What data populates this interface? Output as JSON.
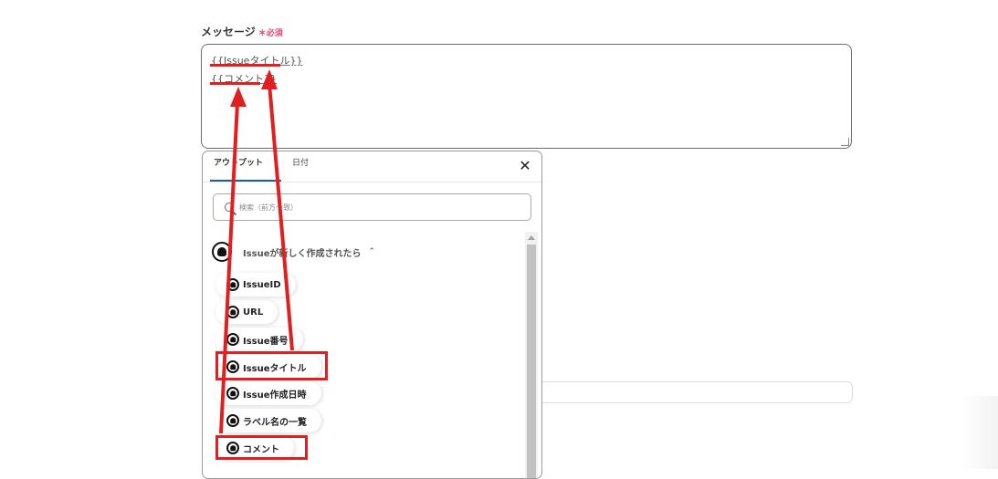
{
  "field": {
    "label": "メッセージ",
    "required_mark": "＊",
    "required_text": "必須"
  },
  "textarea": {
    "line1": "{{Issueタイトル}}",
    "line2": "{{コメント}}"
  },
  "popup": {
    "tabs": [
      {
        "label": "アウトプット",
        "active": true
      },
      {
        "label": "日付",
        "active": false
      }
    ],
    "close_glyph": "✕",
    "search_placeholder": "検索（前方一致）",
    "section": {
      "title": "Issueが新しく作成されたら",
      "chevron": "^",
      "icon": "github-icon"
    },
    "items": [
      {
        "label": "IssueID",
        "highlighted": false
      },
      {
        "label": "URL",
        "highlighted": false
      },
      {
        "label": "Issue番号",
        "highlighted": false
      },
      {
        "label": "Issueタイトル",
        "highlighted": true
      },
      {
        "label": "Issue作成日時",
        "highlighted": false
      },
      {
        "label": "ラベル名の一覧",
        "highlighted": false
      },
      {
        "label": "コメント",
        "highlighted": true
      }
    ]
  },
  "colors": {
    "annotation_red": "#e02020",
    "tab_accent": "#1f5f8b",
    "required_pink": "#e6436e"
  }
}
